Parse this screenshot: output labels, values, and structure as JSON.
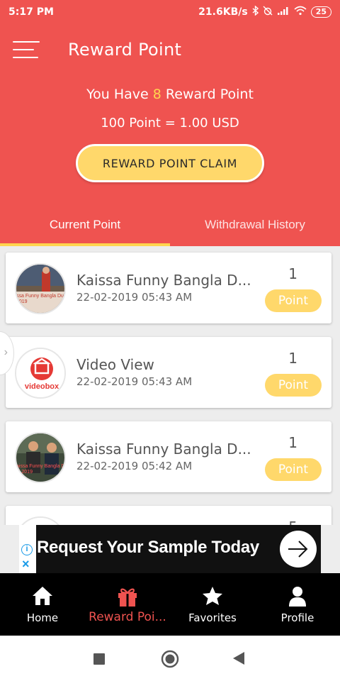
{
  "status_bar": {
    "time": "5:17 PM",
    "network_speed": "21.6KB/s",
    "battery": "25"
  },
  "header": {
    "title": "Reward Point",
    "points_prefix": "You Have",
    "points_value": "8",
    "points_suffix": "Reward Point",
    "rate": "100 Point = 1.00 USD",
    "claim_label": "REWARD POINT CLAIM"
  },
  "tabs": [
    {
      "label": "Current Point",
      "active": true
    },
    {
      "label": "Withdrawal History",
      "active": false
    }
  ],
  "items": [
    {
      "title": "Kaissa Funny Bangla D...",
      "date": "22-02-2019 05:43 AM",
      "count": "1",
      "badge": "Point",
      "thumb_text": "ssa Funny Bangla Dubb\n2019"
    },
    {
      "title": "Video View",
      "date": "22-02-2019 05:43 AM",
      "count": "1",
      "badge": "Point",
      "thumb_text": "videobox"
    },
    {
      "title": "Kaissa Funny Bangla D...",
      "date": "22-02-2019 05:42 AM",
      "count": "1",
      "badge": "Point",
      "thumb_text": "aissa Funny Bangla Dubb\nal 2019"
    },
    {
      "title": "",
      "date": "",
      "count": "5",
      "badge": "",
      "thumb_text": ""
    }
  ],
  "ad": {
    "text": "Request Your Sample Today"
  },
  "bottom_nav": [
    {
      "label": "Home",
      "icon": "home-icon",
      "active": false
    },
    {
      "label": "Reward Poi...",
      "icon": "gift-icon",
      "active": true
    },
    {
      "label": "Favorites",
      "icon": "star-icon",
      "active": false
    },
    {
      "label": "Profile",
      "icon": "person-icon",
      "active": false
    }
  ],
  "colors": {
    "primary": "#ef5350",
    "accent": "#ffd86b",
    "highlight": "#ffd54f"
  }
}
